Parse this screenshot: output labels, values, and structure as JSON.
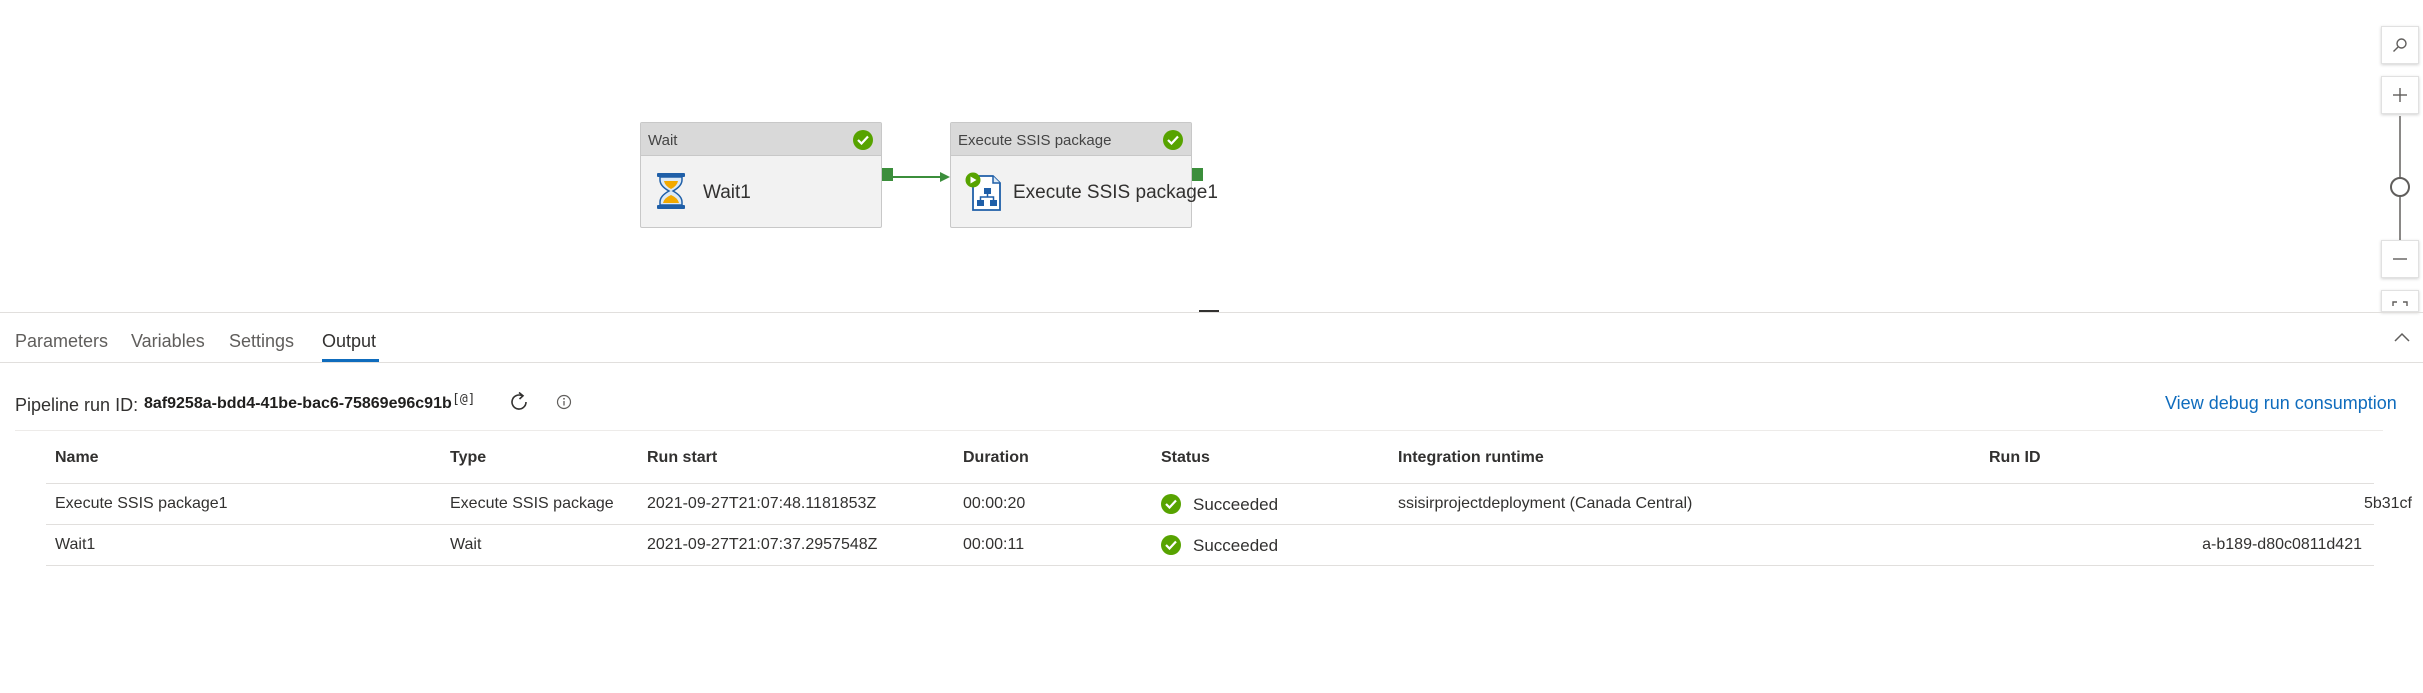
{
  "canvas": {
    "activities": [
      {
        "type_label": "Wait",
        "name": "Wait1",
        "icon": "hourglass-icon",
        "status": "succeeded"
      },
      {
        "type_label": "Execute SSIS package",
        "name": "Execute SSIS package1",
        "icon": "ssis-package-icon",
        "status": "succeeded"
      }
    ],
    "zoom_controls": [
      "search-icon",
      "zoom-in-icon",
      "zoom-out-icon",
      "fit-to-screen-icon"
    ]
  },
  "tabs": [
    {
      "label": "Parameters",
      "active": false
    },
    {
      "label": "Variables",
      "active": false
    },
    {
      "label": "Settings",
      "active": false
    },
    {
      "label": "Output",
      "active": true
    }
  ],
  "output": {
    "pipeline_run_label": "Pipeline run ID:",
    "pipeline_run_id": "8af9258a-bdd4-41be-bac6-75869e96c91b",
    "copy_icon_text": "[@]",
    "debug_link": "View debug run consumption",
    "columns": [
      "Name",
      "Type",
      "Run start",
      "Duration",
      "Status",
      "Integration runtime",
      "Run ID"
    ],
    "rows": [
      {
        "name": "Execute SSIS package1",
        "type": "Execute SSIS package",
        "run_start": "2021-09-27T21:07:48.1181853Z",
        "duration": "00:00:20",
        "status": "Succeeded",
        "integration_runtime": "ssisirprojectdeployment (Canada Central)",
        "run_id": "5b31cf"
      },
      {
        "name": "Wait1",
        "type": "Wait",
        "run_start": "2021-09-27T21:07:37.2957548Z",
        "duration": "00:00:11",
        "status": "Succeeded",
        "integration_runtime": "",
        "run_id": "a-b189-d80c0811d421"
      }
    ]
  },
  "colors": {
    "success": "#57a300",
    "link": "#0f6cbd",
    "port": "#3b8e3b"
  }
}
